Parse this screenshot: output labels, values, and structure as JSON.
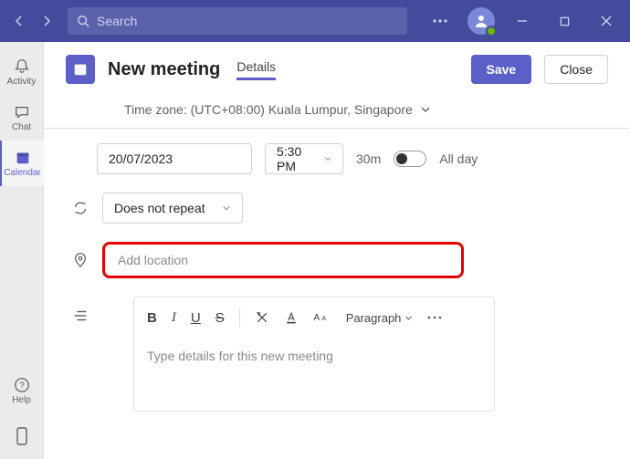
{
  "titlebar": {
    "search_placeholder": "Search"
  },
  "sidebar": {
    "items": [
      {
        "label": "Activity"
      },
      {
        "label": "Chat"
      },
      {
        "label": "Calendar"
      },
      {
        "label": "Help"
      }
    ]
  },
  "header": {
    "title": "New meeting",
    "tab": "Details",
    "save": "Save",
    "close": "Close"
  },
  "timezone": {
    "label": "Time zone: (UTC+08:00) Kuala Lumpur, Singapore"
  },
  "form": {
    "date": "20/07/2023",
    "time": "5:30 PM",
    "duration": "30m",
    "allday": "All day",
    "repeat": "Does not repeat",
    "location_placeholder": "Add location",
    "paragraph": "Paragraph",
    "details_placeholder": "Type details for this new meeting"
  }
}
